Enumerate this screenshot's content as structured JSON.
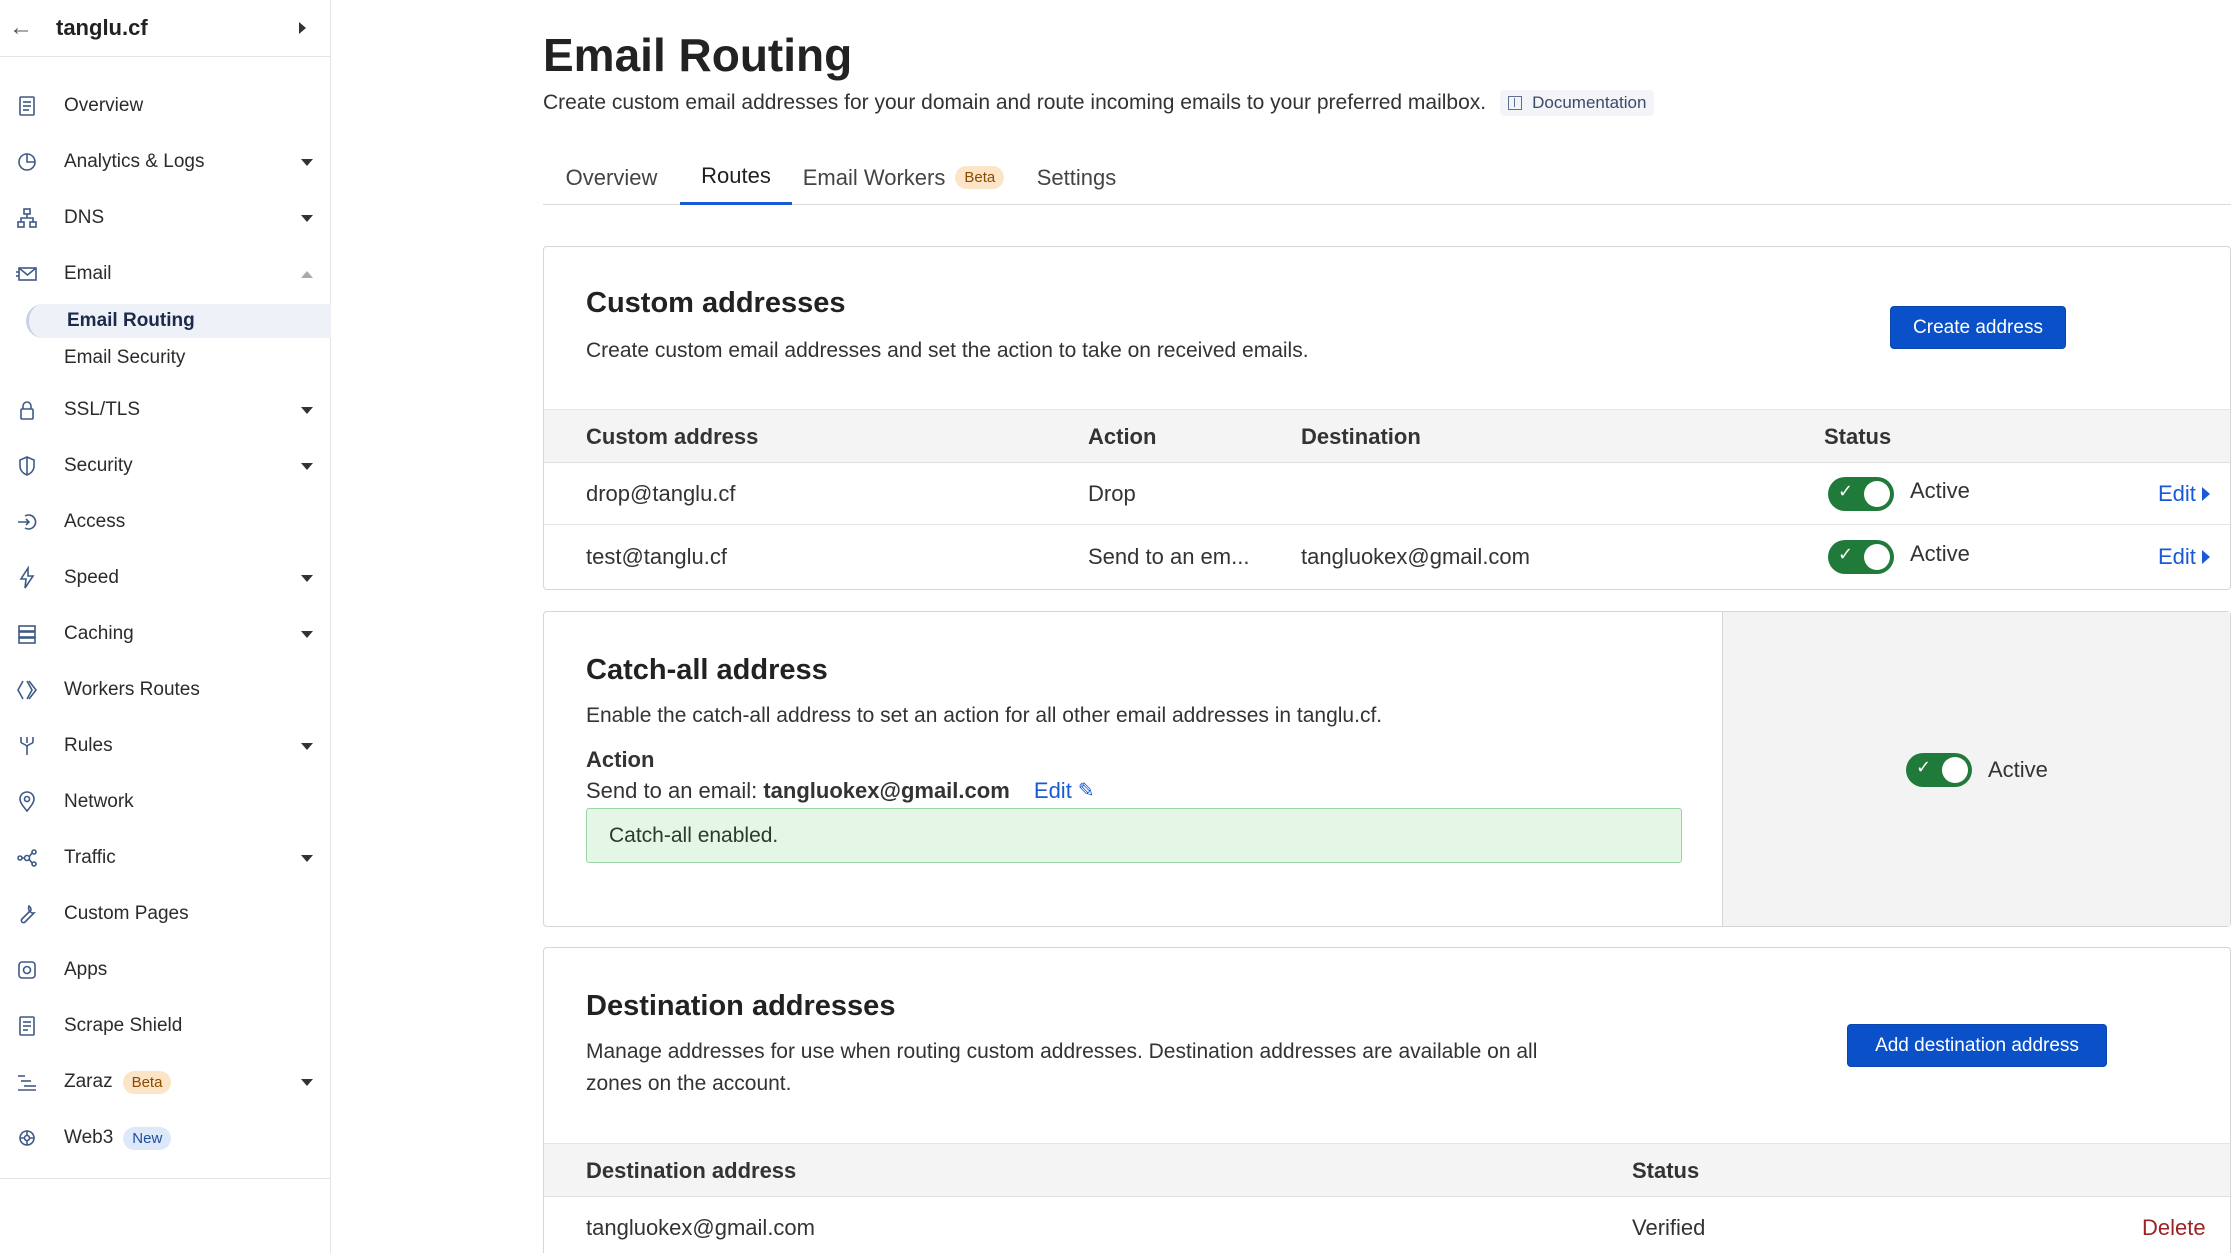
{
  "sidebar": {
    "domain": "tanglu.cf",
    "items": [
      {
        "label": "Overview"
      },
      {
        "label": "Analytics & Logs"
      },
      {
        "label": "DNS"
      },
      {
        "label": "Email"
      },
      {
        "label": "SSL/TLS"
      },
      {
        "label": "Security"
      },
      {
        "label": "Access"
      },
      {
        "label": "Speed"
      },
      {
        "label": "Caching"
      },
      {
        "label": "Workers Routes"
      },
      {
        "label": "Rules"
      },
      {
        "label": "Network"
      },
      {
        "label": "Traffic"
      },
      {
        "label": "Custom Pages"
      },
      {
        "label": "Apps"
      },
      {
        "label": "Scrape Shield"
      },
      {
        "label": "Zaraz",
        "badge": "Beta"
      },
      {
        "label": "Web3",
        "badge": "New"
      }
    ],
    "email_sub": [
      "Email Routing",
      "Email Security"
    ]
  },
  "header": {
    "title": "Email Routing",
    "description": "Create custom email addresses for your domain and route incoming emails to your preferred mailbox.",
    "doc_link": "Documentation"
  },
  "tabs": [
    {
      "label": "Overview"
    },
    {
      "label": "Routes"
    },
    {
      "label": "Email Workers",
      "badge": "Beta"
    },
    {
      "label": "Settings"
    }
  ],
  "custom": {
    "title": "Custom addresses",
    "description": "Create custom email addresses and set the action to take on received emails.",
    "button": "Create address",
    "columns": [
      "Custom address",
      "Action",
      "Destination",
      "Status"
    ],
    "rows": [
      {
        "address": "drop@tanglu.cf",
        "action": "Drop",
        "destination": "",
        "status": "Active",
        "edit": "Edit"
      },
      {
        "address": "test@tanglu.cf",
        "action": "Send to an em...",
        "destination": "tangluokex@gmail.com",
        "status": "Active",
        "edit": "Edit"
      }
    ]
  },
  "catchall": {
    "title": "Catch-all address",
    "description": "Enable the catch-all address to set an action for all other email addresses in tanglu.cf.",
    "action_label": "Action",
    "action_prefix": "Send to an email:",
    "action_email": "tangluokex@gmail.com",
    "edit": "Edit",
    "success": "Catch-all enabled.",
    "status": "Active"
  },
  "destination": {
    "title": "Destination addresses",
    "description_line1": "Manage addresses for use when routing custom addresses. Destination addresses are available on all",
    "description_line2": "zones on the account.",
    "button": "Add destination address",
    "columns": [
      "Destination address",
      "Status"
    ],
    "rows": [
      {
        "address": "tangluokex@gmail.com",
        "status": "Verified",
        "action": "Delete"
      }
    ]
  },
  "colors": {
    "accent": "#0a51c9",
    "toggle_on": "#207a3a",
    "success_bg": "#e4f6e6",
    "delete": "#9b2424"
  }
}
